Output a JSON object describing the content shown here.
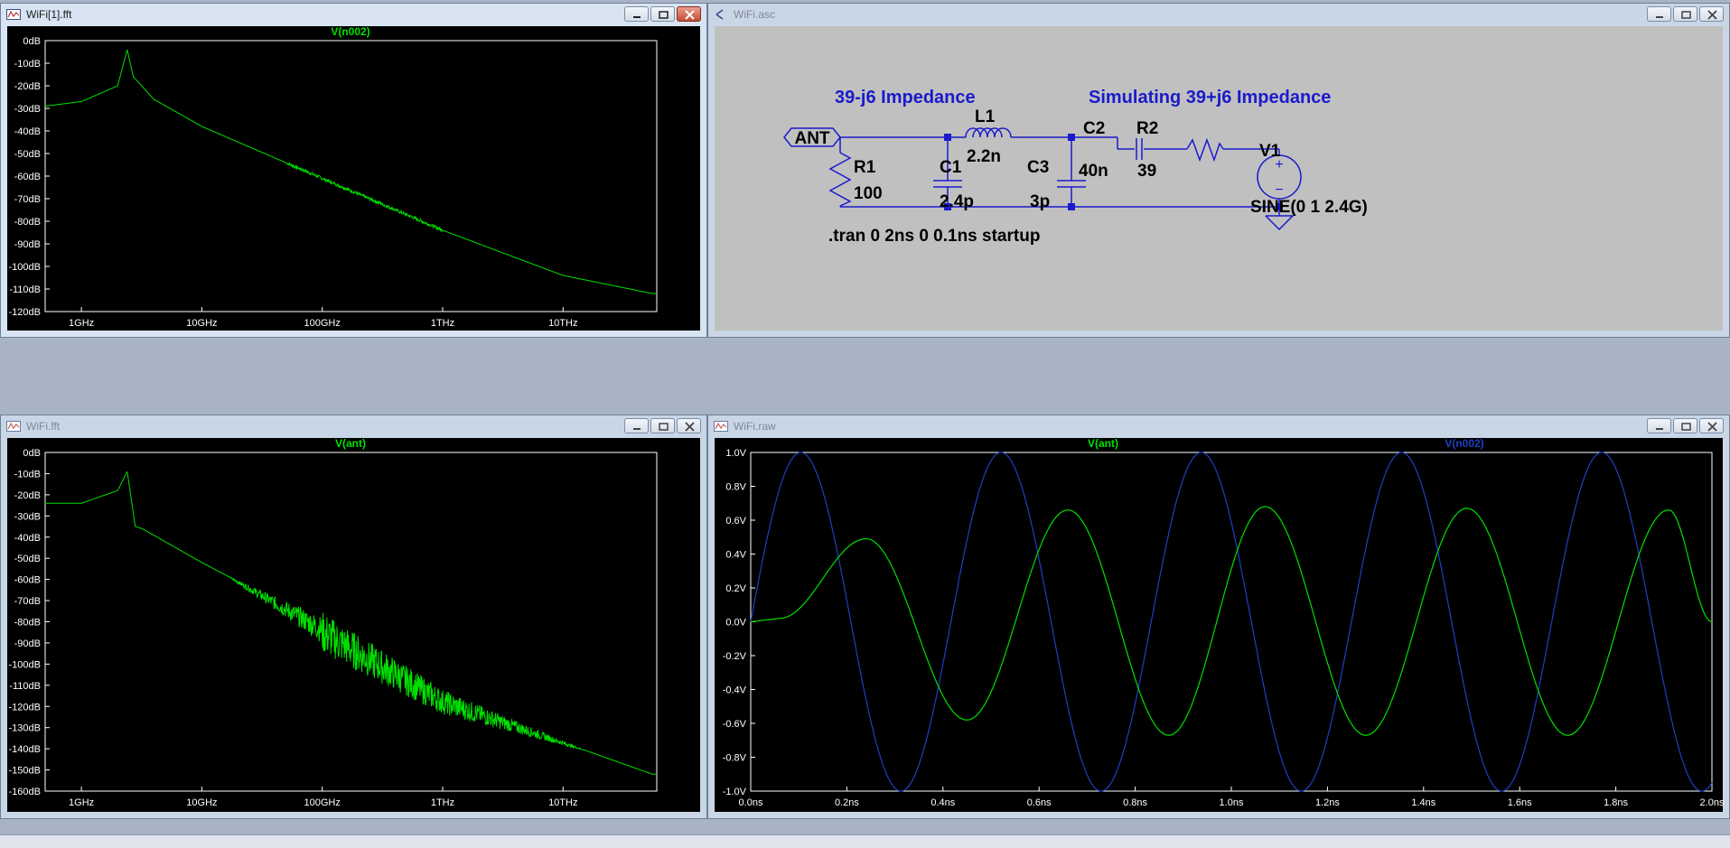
{
  "windows": {
    "fft1": {
      "title": "WiFi[1].fft",
      "trace": "V(n002)",
      "y_ticks": [
        "0dB",
        "-10dB",
        "-20dB",
        "-30dB",
        "-40dB",
        "-50dB",
        "-60dB",
        "-70dB",
        "-80dB",
        "-90dB",
        "-100dB",
        "-110dB",
        "-120dB"
      ],
      "x_ticks": [
        "1GHz",
        "10GHz",
        "100GHz",
        "1THz",
        "10THz"
      ]
    },
    "schematic": {
      "title": "WiFi.asc",
      "label_left": "39-j6 Impedance",
      "label_right": "Simulating 39+j6 Impedance",
      "port": "ANT",
      "r1_name": "R1",
      "r1_value": "100",
      "c1_name": "C1",
      "c1_value": "2.4p",
      "l1_name": "L1",
      "l1_value": "2.2n",
      "c3_name": "C3",
      "c3_value": "3p",
      "c2_name": "C2",
      "c2_value": "40n",
      "r2_name": "R2",
      "r2_value": "39",
      "v1_name": "V1",
      "v1_value": "SINE(0 1 2.4G)",
      "directive": ".tran 0 2ns 0 0.1ns startup"
    },
    "fft2": {
      "title": "WiFi.fft",
      "trace": "V(ant)",
      "y_ticks": [
        "0dB",
        "-10dB",
        "-20dB",
        "-30dB",
        "-40dB",
        "-50dB",
        "-60dB",
        "-70dB",
        "-80dB",
        "-90dB",
        "-100dB",
        "-110dB",
        "-120dB",
        "-130dB",
        "-140dB",
        "-150dB",
        "-160dB"
      ],
      "x_ticks": [
        "1GHz",
        "10GHz",
        "100GHz",
        "1THz",
        "10THz"
      ]
    },
    "raw": {
      "title": "WiFi.raw",
      "trace1": "V(ant)",
      "trace2": "V(n002)",
      "y_ticks": [
        "1.0V",
        "0.8V",
        "0.6V",
        "0.4V",
        "0.2V",
        "0.0V",
        "-0.2V",
        "-0.4V",
        "-0.6V",
        "-0.8V",
        "-1.0V"
      ],
      "x_ticks": [
        "0.0ns",
        "0.2ns",
        "0.4ns",
        "0.6ns",
        "0.8ns",
        "1.0ns",
        "1.2ns",
        "1.4ns",
        "1.6ns",
        "1.8ns",
        "2.0ns"
      ]
    }
  },
  "colors": {
    "trace_green": "#00e000",
    "trace_blue": "#1f3fc0",
    "schematic_wire": "#1a1acc",
    "schematic_label": "#1a1acc",
    "grid_background": "#000000",
    "schematic_background": "#c0c0c0"
  },
  "chart_data": [
    {
      "type": "line",
      "title": "V(n002)",
      "xscale": "log",
      "xlim_hz": [
        500000000.0,
        60000000000000.0
      ],
      "ylim_db": [
        -120,
        0
      ],
      "series": [
        {
          "name": "V(n002)",
          "x_hz": [
            500000000.0,
            1000000000.0,
            2000000000.0,
            2400000000.0,
            2700000000.0,
            4000000000.0,
            10000000000.0,
            100000000000.0,
            1000000000000.0,
            10000000000000.0,
            55000000000000.0
          ],
          "y_db": [
            -29,
            -27,
            -20,
            -4,
            -16,
            -26,
            -38,
            -61,
            -84,
            -104,
            -112
          ]
        }
      ]
    },
    {
      "type": "line",
      "title": "V(ant)",
      "xscale": "log",
      "xlim_hz": [
        500000000.0,
        60000000000000.0
      ],
      "ylim_db": [
        -160,
        0
      ],
      "series": [
        {
          "name": "V(ant)",
          "x_hz": [
            500000000.0,
            1000000000.0,
            2000000000.0,
            2400000000.0,
            2800000000.0,
            3200000000.0,
            10000000000.0,
            100000000000.0,
            1000000000000.0,
            10000000000000.0,
            55000000000000.0
          ],
          "y_db": [
            -24,
            -24,
            -18,
            -9,
            -35,
            -36,
            -52,
            -82,
            -116,
            -137,
            -152
          ]
        }
      ]
    },
    {
      "type": "line",
      "xlim_ns": [
        0,
        2
      ],
      "ylim_v": [
        -1,
        1
      ],
      "series": [
        {
          "name": "V(ant)",
          "x_ns": [
            0,
            0.06,
            0.24,
            0.45,
            0.66,
            0.87,
            1.07,
            1.28,
            1.49,
            1.7,
            1.91,
            2.0
          ],
          "y_v": [
            0,
            0.02,
            0.49,
            -0.58,
            0.66,
            -0.67,
            0.68,
            -0.67,
            0.67,
            -0.67,
            0.66,
            0.0
          ]
        },
        {
          "name": "V(n002)",
          "amplitude": 1.0,
          "frequency_ghz": 2.4
        }
      ]
    }
  ]
}
